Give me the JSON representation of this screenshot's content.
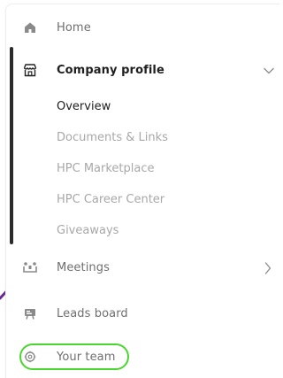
{
  "nav": {
    "home": {
      "label": "Home",
      "icon": "home-icon"
    },
    "company_profile": {
      "label": "Company profile",
      "icon": "shop-icon",
      "expanded": true,
      "sub_items": [
        {
          "label": "Overview",
          "active": true
        },
        {
          "label": "Documents & Links",
          "active": false
        },
        {
          "label": "HPC Marketplace",
          "active": false
        },
        {
          "label": "HPC Career Center",
          "active": false
        },
        {
          "label": "Giveaways",
          "active": false
        }
      ]
    },
    "meetings": {
      "label": "Meetings",
      "icon": "meetings-icon"
    },
    "leads_board": {
      "label": "Leads board",
      "icon": "leads-board-icon"
    },
    "your_team": {
      "label": "Your team",
      "icon": "gear-icon",
      "highlighted": true
    }
  },
  "colors": {
    "active_text": "#1d1d1d",
    "muted_text": "#a8a8a8",
    "highlight_ring": "#49d62e",
    "deco_line": "#6b2a8f"
  }
}
